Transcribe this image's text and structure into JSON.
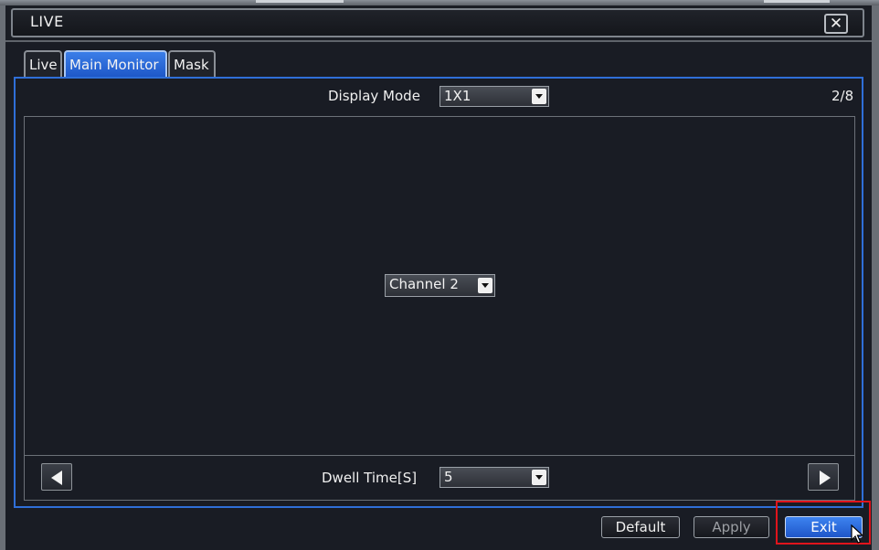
{
  "window": {
    "title": "LIVE",
    "close_icon": "close-icon"
  },
  "tabs": [
    {
      "label": "Live",
      "active": false
    },
    {
      "label": "Main Monitor",
      "active": true
    },
    {
      "label": "Mask",
      "active": false
    }
  ],
  "display_mode": {
    "label": "Display Mode",
    "value": "1X1"
  },
  "page_indicator": "2/8",
  "channel_select": {
    "value": "Channel 2"
  },
  "dwell": {
    "label": "Dwell Time[S]",
    "value": "5"
  },
  "nav": {
    "prev_icon": "arrow-left-icon",
    "next_icon": "arrow-right-icon"
  },
  "buttons": {
    "default_label": "Default",
    "apply_label": "Apply",
    "exit_label": "Exit"
  },
  "colors": {
    "accent": "#2f6fd8",
    "highlight": "#e0141c",
    "background": "#191c24"
  }
}
